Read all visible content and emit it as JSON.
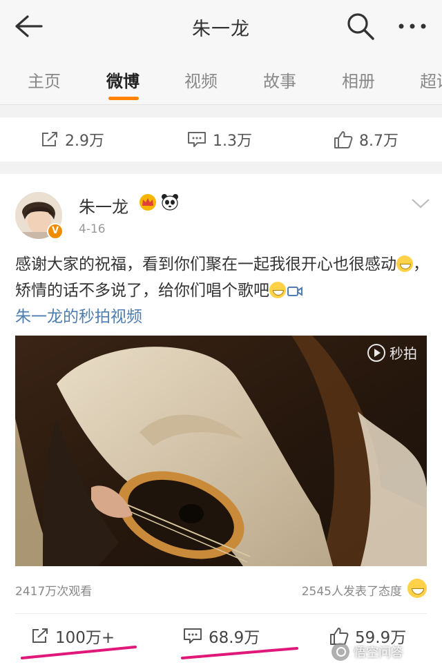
{
  "header": {
    "title": "朱一龙",
    "back_icon": "arrow-left-icon",
    "search_icon": "search-icon",
    "more_icon": "more-dots-icon"
  },
  "tabs": [
    {
      "label": "主页",
      "active": false
    },
    {
      "label": "微博",
      "active": true
    },
    {
      "label": "视频",
      "active": false
    },
    {
      "label": "故事",
      "active": false
    },
    {
      "label": "相册",
      "active": false
    },
    {
      "label": "超话",
      "active": false
    }
  ],
  "accent_color": "#ff8200",
  "previous_post_actions": {
    "repost": "2.9万",
    "comment": "1.3万",
    "like": "8.7万"
  },
  "post": {
    "username": "朱一龙",
    "badges": [
      "crown-icon",
      "panda-icon"
    ],
    "verified_badge": "V",
    "date": "4-16",
    "text_part1": "感谢大家的祝福，看到你们聚在一起我很开心也很感动",
    "text_part2": "，矫情的话不多说了，给你们唱个歌吧",
    "video_link": "朱一龙的秒拍视频",
    "link_color": "#507daf",
    "video_watermark": "秒拍",
    "views": "2417万次观看",
    "reactions": "2545人发表了态度",
    "actions": {
      "repost": "100万+",
      "comment": "68.9万",
      "like": "59.9万"
    }
  },
  "footer_logo": "悟空问答"
}
